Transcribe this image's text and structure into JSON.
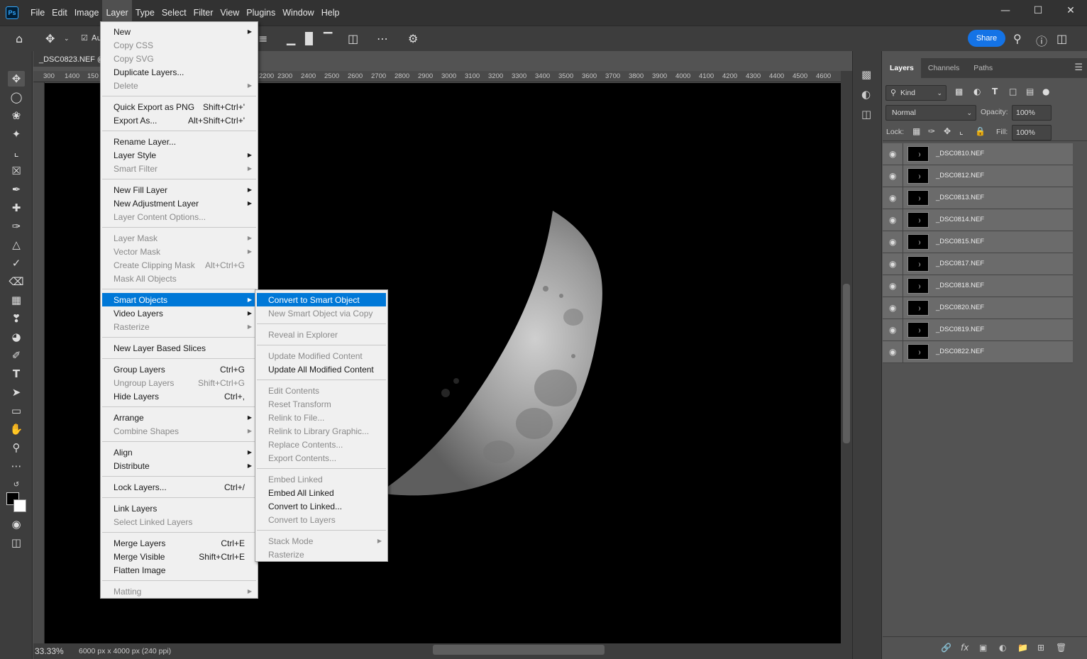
{
  "app": {
    "logo": "Ps",
    "menus": [
      "File",
      "Edit",
      "Image",
      "Layer",
      "Type",
      "Select",
      "Filter",
      "View",
      "Plugins",
      "Window",
      "Help"
    ],
    "active_menu": "Layer",
    "share_label": "Share"
  },
  "options_bar": {
    "auto_select_label": "Au"
  },
  "document": {
    "tab_title": "_DSC0823.NEF @",
    "ruler_ticks": [
      "300",
      "1400",
      "150",
      "2200",
      "2300",
      "2400",
      "2500",
      "2600",
      "2700",
      "2800",
      "2900",
      "3000",
      "3100",
      "3200",
      "3300",
      "3400",
      "3500",
      "3600",
      "3700",
      "3800",
      "3900",
      "4000",
      "4100",
      "4200",
      "4300",
      "4400",
      "4500",
      "4600"
    ],
    "zoom": "33.33%",
    "info": "6000 px x 4000 px (240 ppi)"
  },
  "layer_menu": {
    "items": [
      {
        "label": "New",
        "submenu": true
      },
      {
        "label": "Copy CSS",
        "disabled": true
      },
      {
        "label": "Copy SVG",
        "disabled": true
      },
      {
        "label": "Duplicate Layers..."
      },
      {
        "label": "Delete",
        "disabled": true,
        "submenu": true
      },
      {
        "sep": true
      },
      {
        "label": "Quick Export as PNG",
        "shortcut": "Shift+Ctrl+'"
      },
      {
        "label": "Export As...",
        "shortcut": "Alt+Shift+Ctrl+'"
      },
      {
        "sep": true
      },
      {
        "label": "Rename Layer..."
      },
      {
        "label": "Layer Style",
        "submenu": true
      },
      {
        "label": "Smart Filter",
        "disabled": true,
        "submenu": true
      },
      {
        "sep": true
      },
      {
        "label": "New Fill Layer",
        "submenu": true
      },
      {
        "label": "New Adjustment Layer",
        "submenu": true
      },
      {
        "label": "Layer Content Options...",
        "disabled": true
      },
      {
        "sep": true
      },
      {
        "label": "Layer Mask",
        "disabled": true,
        "submenu": true
      },
      {
        "label": "Vector Mask",
        "disabled": true,
        "submenu": true
      },
      {
        "label": "Create Clipping Mask",
        "disabled": true,
        "shortcut": "Alt+Ctrl+G"
      },
      {
        "label": "Mask All Objects",
        "disabled": true
      },
      {
        "sep": true
      },
      {
        "label": "Smart Objects",
        "submenu": true,
        "highlighted": true
      },
      {
        "label": "Video Layers",
        "submenu": true
      },
      {
        "label": "Rasterize",
        "disabled": true,
        "submenu": true
      },
      {
        "sep": true
      },
      {
        "label": "New Layer Based Slices"
      },
      {
        "sep": true
      },
      {
        "label": "Group Layers",
        "shortcut": "Ctrl+G"
      },
      {
        "label": "Ungroup Layers",
        "disabled": true,
        "shortcut": "Shift+Ctrl+G"
      },
      {
        "label": "Hide Layers",
        "shortcut": "Ctrl+,"
      },
      {
        "sep": true
      },
      {
        "label": "Arrange",
        "submenu": true
      },
      {
        "label": "Combine Shapes",
        "disabled": true,
        "submenu": true
      },
      {
        "sep": true
      },
      {
        "label": "Align",
        "submenu": true
      },
      {
        "label": "Distribute",
        "submenu": true
      },
      {
        "sep": true
      },
      {
        "label": "Lock Layers...",
        "shortcut": "Ctrl+/"
      },
      {
        "sep": true
      },
      {
        "label": "Link Layers"
      },
      {
        "label": "Select Linked Layers",
        "disabled": true
      },
      {
        "sep": true
      },
      {
        "label": "Merge Layers",
        "shortcut": "Ctrl+E"
      },
      {
        "label": "Merge Visible",
        "shortcut": "Shift+Ctrl+E"
      },
      {
        "label": "Flatten Image"
      },
      {
        "sep": true
      },
      {
        "label": "Matting",
        "disabled": true,
        "submenu": true
      }
    ]
  },
  "smart_objects_menu": {
    "items": [
      {
        "label": "Convert to Smart Object",
        "highlighted": true
      },
      {
        "label": "New Smart Object via Copy",
        "disabled": true
      },
      {
        "sep": true
      },
      {
        "label": "Reveal in Explorer",
        "disabled": true
      },
      {
        "sep": true
      },
      {
        "label": "Update Modified Content",
        "disabled": true
      },
      {
        "label": "Update All Modified Content"
      },
      {
        "sep": true
      },
      {
        "label": "Edit Contents",
        "disabled": true
      },
      {
        "label": "Reset Transform",
        "disabled": true
      },
      {
        "label": "Relink to File...",
        "disabled": true
      },
      {
        "label": "Relink to Library Graphic...",
        "disabled": true
      },
      {
        "label": "Replace Contents...",
        "disabled": true
      },
      {
        "label": "Export Contents...",
        "disabled": true
      },
      {
        "sep": true
      },
      {
        "label": "Embed Linked",
        "disabled": true
      },
      {
        "label": "Embed All Linked"
      },
      {
        "label": "Convert to Linked..."
      },
      {
        "label": "Convert to Layers",
        "disabled": true
      },
      {
        "sep": true
      },
      {
        "label": "Stack Mode",
        "disabled": true,
        "submenu": true
      },
      {
        "label": "Rasterize",
        "disabled": true
      }
    ]
  },
  "layers_panel": {
    "tabs": [
      "Layers",
      "Channels",
      "Paths"
    ],
    "kind_label": "Kind",
    "blend_mode": "Normal",
    "opacity_label": "Opacity:",
    "opacity": "100%",
    "lock_label": "Lock:",
    "fill_label": "Fill:",
    "fill": "100%",
    "layers": [
      "_DSC0810.NEF",
      "_DSC0812.NEF",
      "_DSC0813.NEF",
      "_DSC0814.NEF",
      "_DSC0815.NEF",
      "_DSC0817.NEF",
      "_DSC0818.NEF",
      "_DSC0820.NEF",
      "_DSC0819.NEF",
      "_DSC0822.NEF"
    ]
  },
  "colors": {
    "highlight": "#0078d7",
    "share": "#1473e6"
  }
}
